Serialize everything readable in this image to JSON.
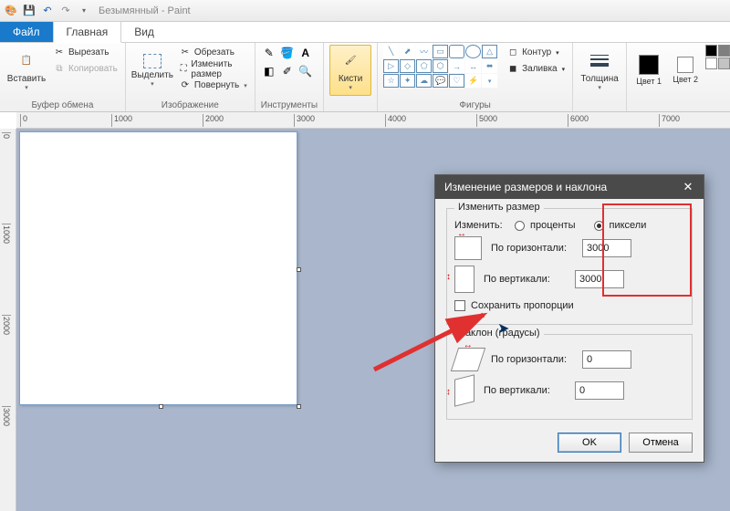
{
  "titlebar": {
    "title": "Безымянный - Paint"
  },
  "tabs": {
    "file": "Файл",
    "home": "Главная",
    "view": "Вид"
  },
  "ribbon": {
    "clipboard": {
      "label": "Буфер обмена",
      "paste": "Вставить",
      "cut": "Вырезать",
      "copy": "Копировать"
    },
    "image": {
      "label": "Изображение",
      "select": "Выделить",
      "crop": "Обрезать",
      "resize": "Изменить размер",
      "rotate": "Повернуть"
    },
    "tools": {
      "label": "Инструменты"
    },
    "brushes": {
      "label": "Кисти"
    },
    "shapes": {
      "label": "Фигуры",
      "outline": "Контур",
      "fill": "Заливка"
    },
    "size": {
      "label": "Толщина"
    },
    "colors": {
      "label1": "Цвет 1",
      "label2": "Цвет 2"
    }
  },
  "ruler": {
    "h": [
      "0",
      "1000",
      "2000",
      "3000",
      "4000",
      "5000",
      "6000",
      "7000"
    ],
    "v": [
      "0",
      "1000",
      "2000",
      "3000"
    ]
  },
  "dialog": {
    "title": "Изменение размеров и наклона",
    "resize_legend": "Изменить размер",
    "by_label": "Изменить:",
    "percent": "проценты",
    "pixels": "пиксели",
    "horiz": "По горизонтали:",
    "vert": "По вертикали:",
    "h_value": "3000",
    "v_value": "3000",
    "keep_ratio": "Сохранить пропорции",
    "skew_legend": "Наклон (градусы)",
    "skew_h": "0",
    "skew_v": "0",
    "ok": "OK",
    "cancel": "Отмена"
  },
  "palette": [
    "#000",
    "#7f7f7f",
    "#880015",
    "#ed1c24",
    "#ff7f27",
    "#fff200",
    "#22b14c",
    "#00a2e8",
    "#3f48cc",
    "#a349a4",
    "#fff",
    "#c3c3c3",
    "#b97a57",
    "#ffaec9",
    "#ffc90e",
    "#efe4b0",
    "#b5e61d",
    "#99d9ea",
    "#7092be",
    "#c8bfe7"
  ]
}
